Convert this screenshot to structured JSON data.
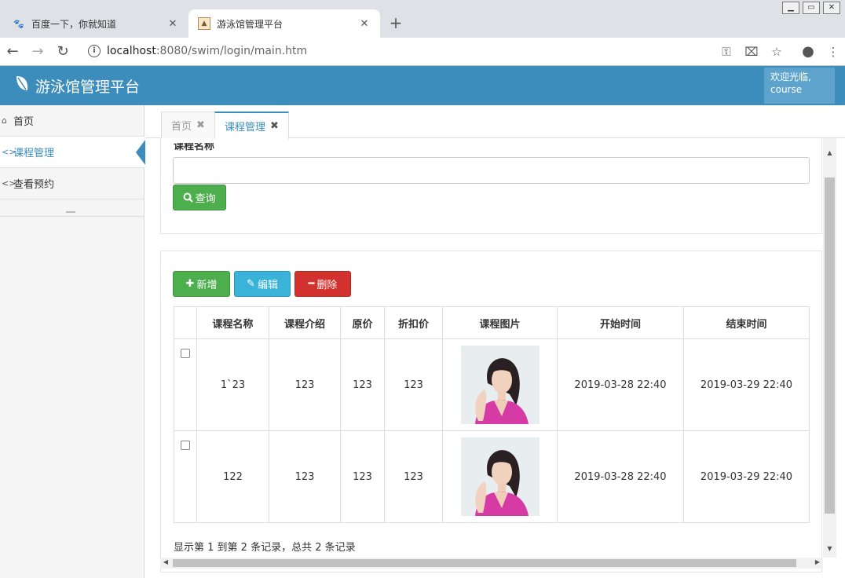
{
  "browser": {
    "tabs": [
      {
        "title": "百度一下，你就知道",
        "close": "✕"
      },
      {
        "title": "游泳馆管理平台",
        "close": "✕"
      }
    ],
    "new_tab": "+",
    "url_host": "localhost",
    "url_rest": ":8080/swim/login/main.htm"
  },
  "header": {
    "title": "游泳馆管理平台",
    "welcome_line1": "欢迎光临,",
    "welcome_line2": "course",
    "color": "#3c8dbc"
  },
  "sidebar": {
    "items": [
      {
        "label": "首页",
        "icon": "home-icon"
      },
      {
        "label": "课程管理",
        "icon": "code-icon"
      },
      {
        "label": "查看预约",
        "icon": "code-icon"
      }
    ]
  },
  "content_tabs": [
    {
      "label": "首页",
      "close": "✖"
    },
    {
      "label": "课程管理",
      "close": "✖"
    }
  ],
  "search": {
    "label": "课程名称",
    "value": "",
    "button": "查询"
  },
  "actions": {
    "add": "新增",
    "edit": "编辑",
    "delete": "删除"
  },
  "table": {
    "columns": [
      "课程名称",
      "课程介绍",
      "原价",
      "折扣价",
      "课程图片",
      "开始时间",
      "结束时间"
    ],
    "rows": [
      {
        "name": "1`23",
        "intro": "123",
        "price": "123",
        "discount": "123",
        "start": "2019-03-28 22:40",
        "end": "2019-03-29 22:40"
      },
      {
        "name": "122",
        "intro": "123",
        "price": "123",
        "discount": "123",
        "start": "2019-03-28 22:40",
        "end": "2019-03-29 22:40"
      }
    ]
  },
  "pagination_text": "显示第 1 到第 2 条记录，总共 2 条记录"
}
